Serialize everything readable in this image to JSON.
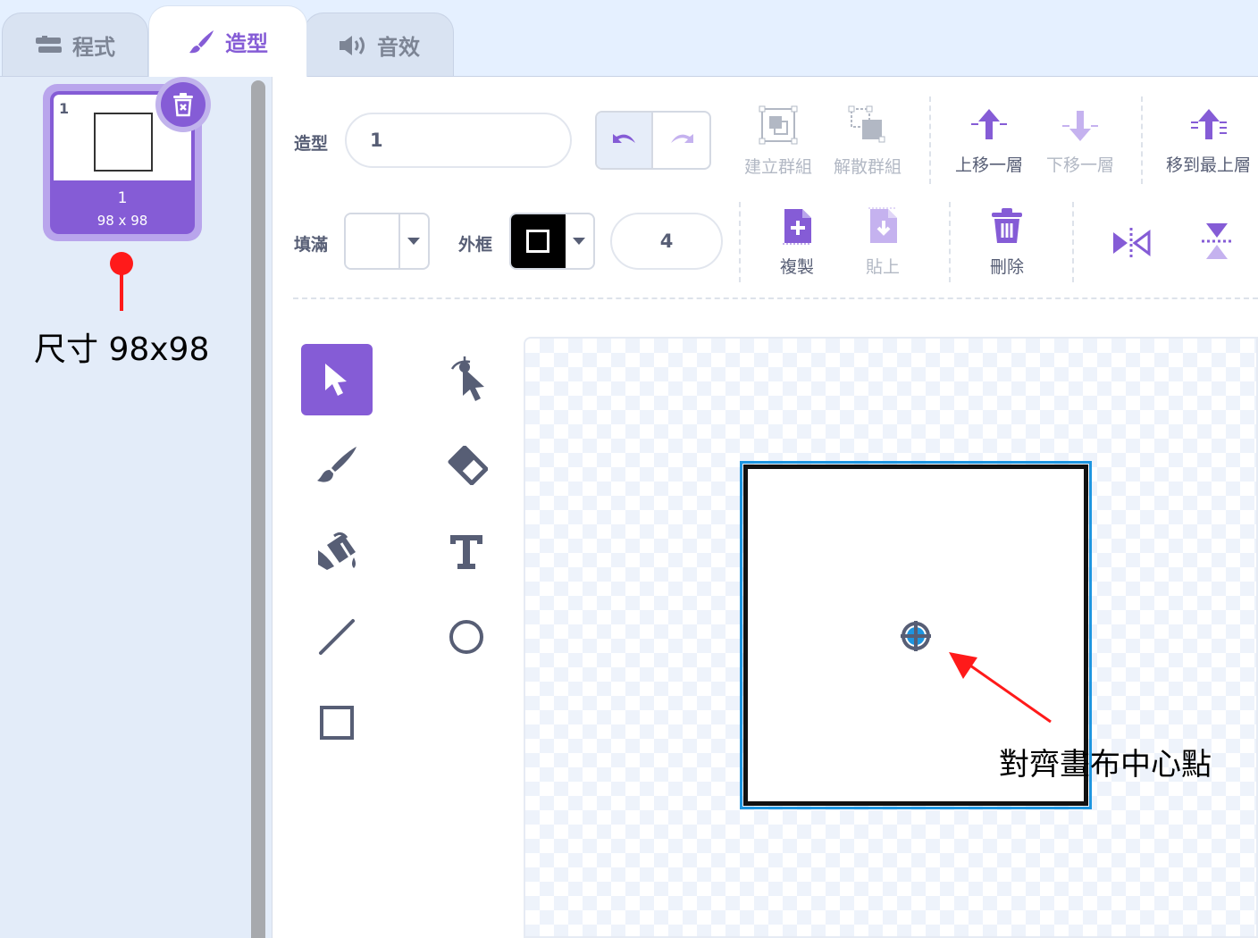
{
  "tabs": [
    {
      "label": "程式",
      "icon": "code-blocks-icon"
    },
    {
      "label": "造型",
      "icon": "paintbrush-icon",
      "active": true
    },
    {
      "label": "音效",
      "icon": "speaker-icon"
    }
  ],
  "costume_list": {
    "items": [
      {
        "index": "1",
        "name": "1",
        "size": "98 x 98",
        "selected": true
      }
    ]
  },
  "annotations": {
    "size_note": "尺寸 98x98",
    "center_note": "對齊畫布中心點"
  },
  "toolbar": {
    "costume_label": "造型",
    "costume_name": "1",
    "group": "建立群組",
    "ungroup": "解散群組",
    "forward": "上移一層",
    "backward": "下移一層",
    "front": "移到最上層",
    "fill_label": "填滿",
    "outline_label": "外框",
    "outline_width": "4",
    "copy": "複製",
    "paste": "貼上",
    "delete": "刪除"
  },
  "colors": {
    "accent": "#855cd6",
    "fill": "#ffffff",
    "outline": "#000000",
    "selection": "#1d95e0",
    "annotation": "#ff1a1a"
  }
}
